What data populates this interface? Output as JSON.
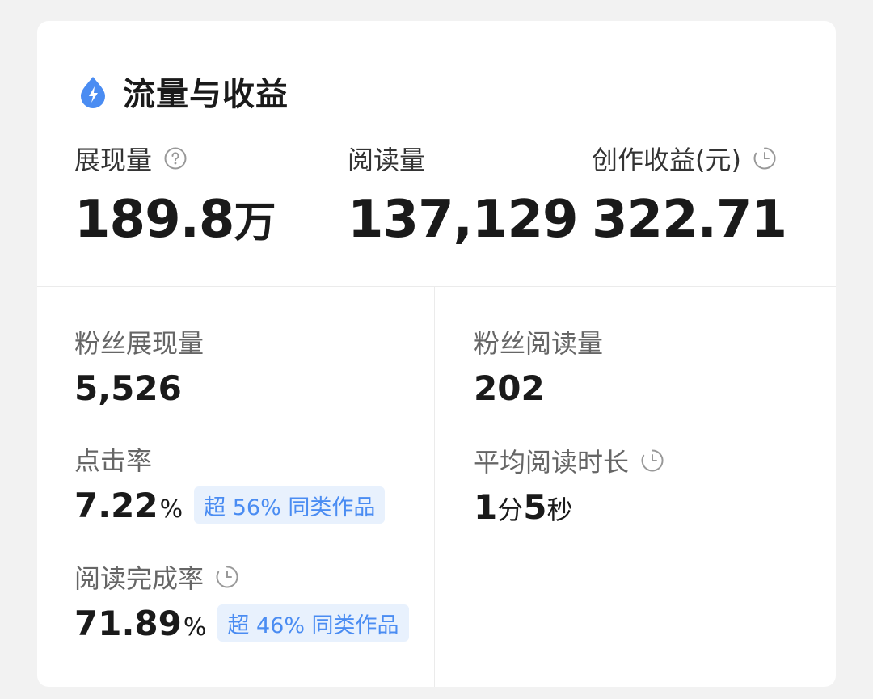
{
  "header": {
    "title": "流量与收益",
    "icon": "lightning-drop-icon"
  },
  "top_metrics": [
    {
      "label": "展现量",
      "value": "189.8",
      "unit": "万",
      "icon": "question-circle-icon"
    },
    {
      "label": "阅读量",
      "value": "137,129"
    },
    {
      "label": "创作收益(元)",
      "value": "322.71",
      "icon": "clock-icon"
    }
  ],
  "left_metrics": [
    {
      "label": "粉丝展现量",
      "value": "5,526"
    },
    {
      "label": "点击率",
      "value": "7.22",
      "unit": "%",
      "badge": "超 56% 同类作品"
    },
    {
      "label": "阅读完成率",
      "value": "71.89",
      "unit": "%",
      "badge": "超 46% 同类作品",
      "icon": "clock-icon"
    }
  ],
  "right_metrics": [
    {
      "label": "粉丝阅读量",
      "value": "202"
    },
    {
      "label": "平均阅读时长",
      "value_min": "1",
      "unit_min": "分",
      "value_sec": "5",
      "unit_sec": "秒",
      "icon": "clock-icon"
    }
  ],
  "colors": {
    "accent": "#4a8cf2",
    "badge_bg": "#e8f1fd"
  }
}
